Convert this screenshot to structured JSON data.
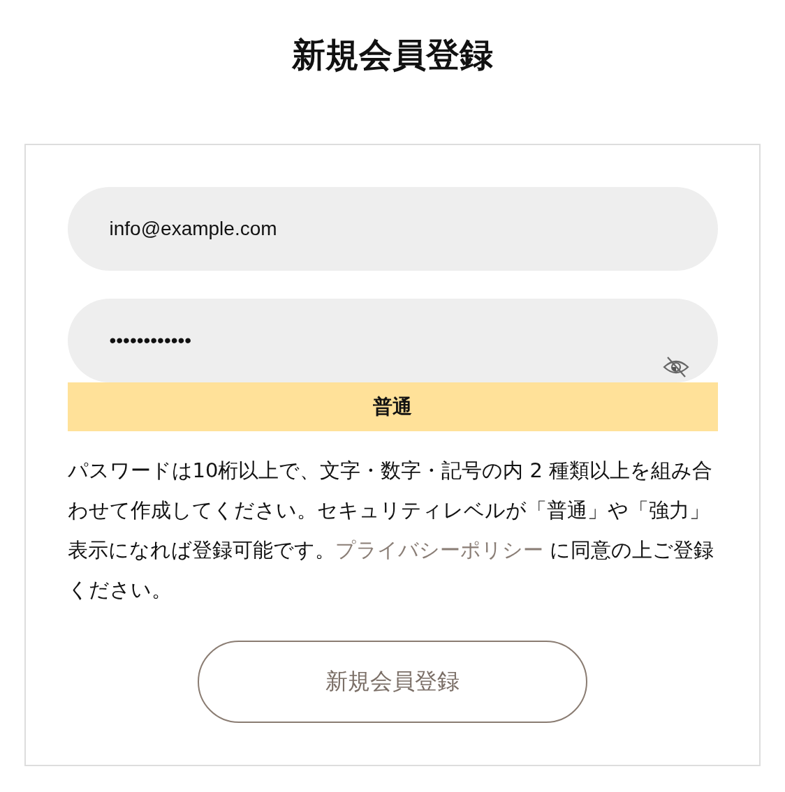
{
  "title": "新規会員登録",
  "email": {
    "value": "info@example.com"
  },
  "password": {
    "value": "••••••••••••",
    "visible": false
  },
  "strength": {
    "label": "普通"
  },
  "notice": {
    "before": "パスワードは10桁以上で、文字・数字・記号の内 2 種類以上を組み合わせて作成してください。セキュリティレベルが「普通」や「強力」表示になれば登録可能です。",
    "link": "プライバシーポリシー",
    "after": " に同意の上ご登録ください。"
  },
  "submit": {
    "label": "新規会員登録"
  }
}
